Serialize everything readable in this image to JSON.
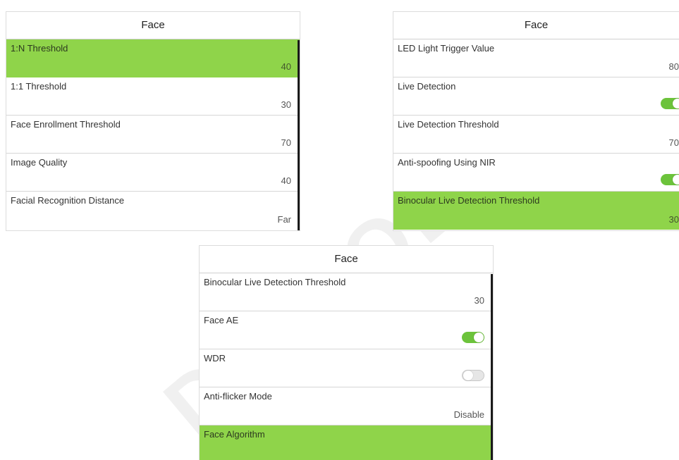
{
  "panel1": {
    "title": "Face",
    "rows": [
      {
        "label": "1:N Threshold",
        "value": "40"
      },
      {
        "label": "1:1 Threshold",
        "value": "30"
      },
      {
        "label": "Face Enrollment Threshold",
        "value": "70"
      },
      {
        "label": "Image Quality",
        "value": "40"
      },
      {
        "label": "Facial Recognition Distance",
        "value": "Far"
      }
    ]
  },
  "panel2": {
    "title": "Face",
    "rows": [
      {
        "label": "LED Light Trigger Value",
        "value": "80"
      },
      {
        "label": "Live Detection",
        "toggle": "on"
      },
      {
        "label": "Live Detection Threshold",
        "value": "70"
      },
      {
        "label": "Anti-spoofing Using NIR",
        "toggle": "on"
      },
      {
        "label": "Binocular Live Detection Threshold",
        "value": "30"
      }
    ]
  },
  "panel3": {
    "title": "Face",
    "rows": [
      {
        "label": "Binocular Live Detection Threshold",
        "value": "30"
      },
      {
        "label": "Face AE",
        "toggle": "on"
      },
      {
        "label": "WDR",
        "toggle": "off"
      },
      {
        "label": "Anti-flicker Mode",
        "value": "Disable"
      },
      {
        "label": "Face Algorithm"
      }
    ]
  },
  "watermark": "D-GLOBAL",
  "colors": {
    "selected_row": "#8fd44a",
    "toggle_on": "#6cc33b",
    "toggle_off": "#e6e6e6"
  }
}
